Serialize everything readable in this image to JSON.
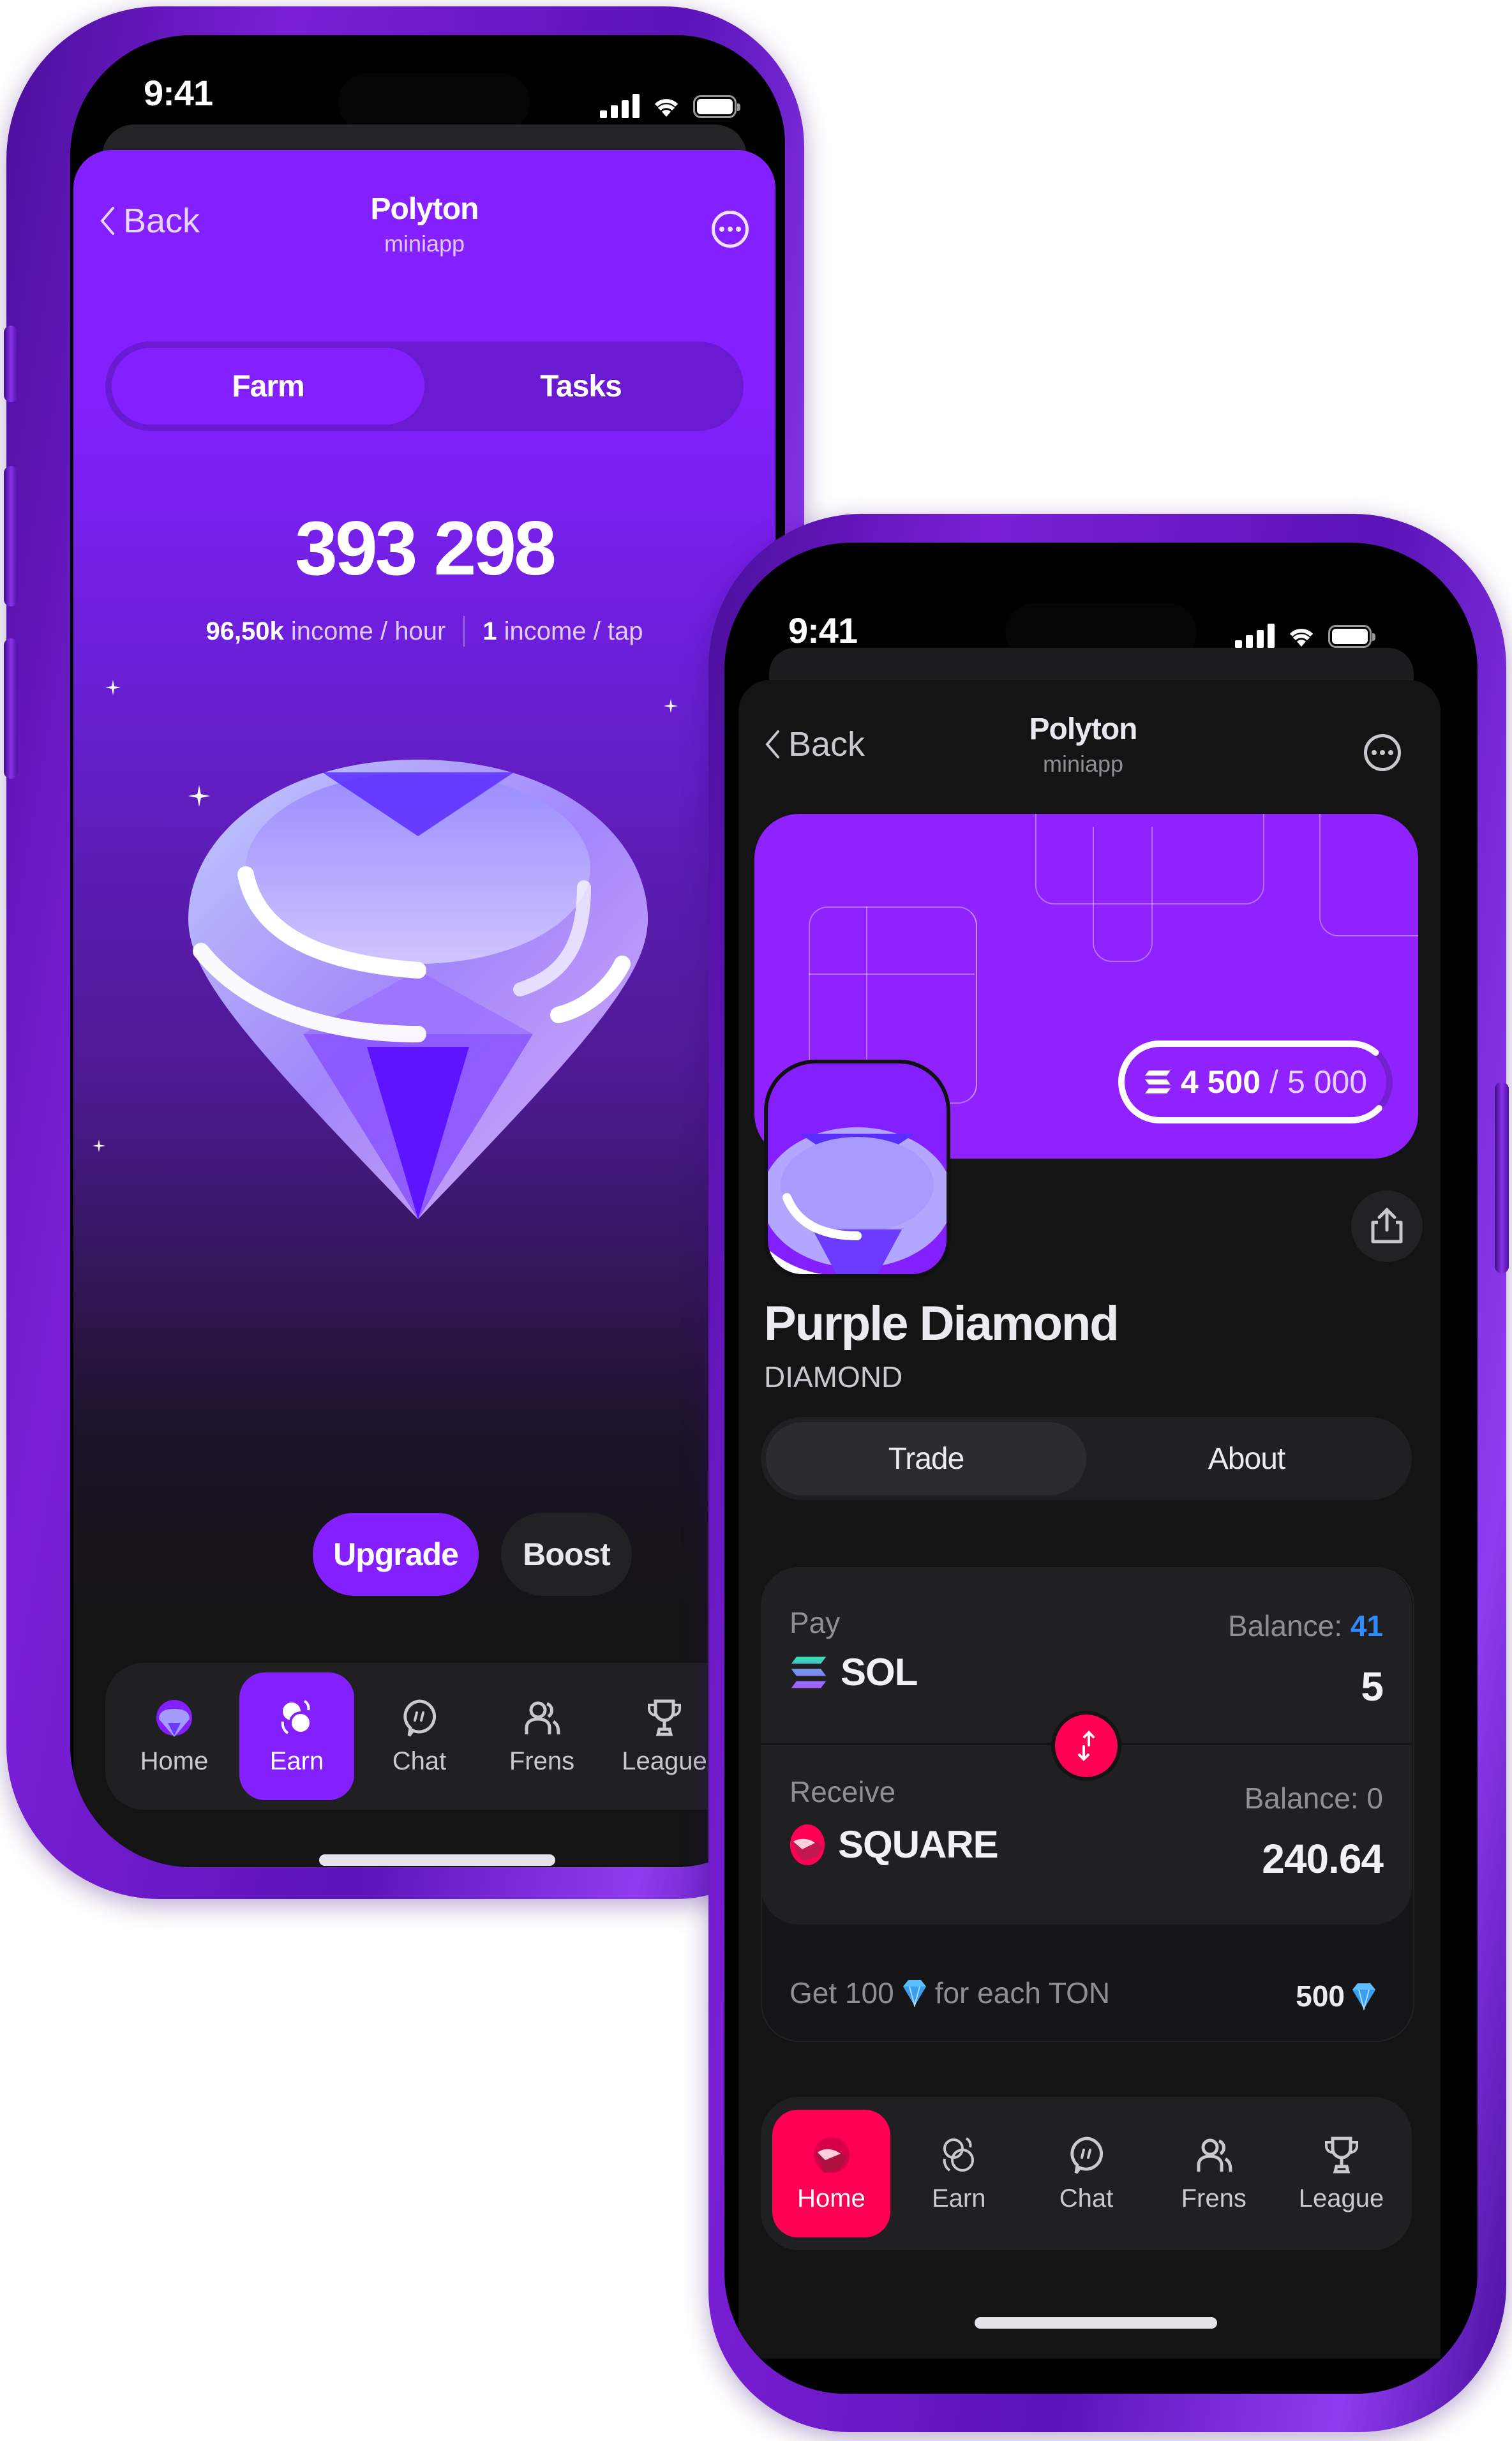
{
  "colors": {
    "brand_purple": "#8420ff",
    "banner_purple": "#9022ff",
    "accent_pink": "#ff0055",
    "balance_blue": "#2f8bff",
    "dark_bg": "#141414",
    "card_bg": "#202023"
  },
  "status_bar": {
    "time": "9:41"
  },
  "left_phone": {
    "header": {
      "back_label": "Back",
      "title": "Polyton",
      "subtitle": "miniapp",
      "more_icon": "more-options-icon"
    },
    "segmented": {
      "tabs": [
        {
          "label": "Farm",
          "active": true
        },
        {
          "label": "Tasks",
          "active": false
        }
      ]
    },
    "balance": {
      "value": "393 298",
      "income_hour_value": "96,50k",
      "income_hour_label": "income / hour",
      "income_tap_value": "1",
      "income_tap_label": "income / tap"
    },
    "hero_image": "purple-diamond-gem",
    "actions": {
      "upgrade_label": "Upgrade",
      "boost_label": "Boost"
    },
    "nav": [
      {
        "label": "Home",
        "icon": "gem-home-icon",
        "active": false
      },
      {
        "label": "Earn",
        "icon": "coins-icon",
        "active": true
      },
      {
        "label": "Chat",
        "icon": "chat-bubble-icon",
        "active": false
      },
      {
        "label": "Frens",
        "icon": "friends-icon",
        "active": false
      },
      {
        "label": "League",
        "icon": "trophy-icon",
        "active": false
      }
    ]
  },
  "right_phone": {
    "header": {
      "back_label": "Back",
      "title": "Polyton",
      "subtitle": "miniapp",
      "more_icon": "more-options-icon"
    },
    "banner": {
      "progress_current": "4 500",
      "progress_separator": "/",
      "progress_total": "5 000",
      "progress_fraction": 0.9,
      "currency_icon": "solana-icon"
    },
    "token": {
      "name": "Purple Diamond",
      "ticker": "DIAMOND",
      "share_icon": "share-icon"
    },
    "segmented": {
      "tabs": [
        {
          "label": "Trade",
          "active": true
        },
        {
          "label": "About",
          "active": false
        }
      ]
    },
    "swap": {
      "pay": {
        "label": "Pay",
        "balance_label": "Balance:",
        "balance_value": "41",
        "token": "SOL",
        "amount": "5"
      },
      "receive": {
        "label": "Receive",
        "balance_label": "Balance:",
        "balance_value": "0",
        "token": "SQUARE",
        "amount": "240.64"
      },
      "swap_icon": "swap-arrows-icon",
      "bonus_prefix": "Get 100",
      "bonus_suffix": "for each TON",
      "bonus_total": "500"
    },
    "nav": [
      {
        "label": "Home",
        "icon": "gem-home-icon",
        "active": true
      },
      {
        "label": "Earn",
        "icon": "coins-icon",
        "active": false
      },
      {
        "label": "Chat",
        "icon": "chat-bubble-icon",
        "active": false
      },
      {
        "label": "Frens",
        "icon": "friends-icon",
        "active": false
      },
      {
        "label": "League",
        "icon": "trophy-icon",
        "active": false
      }
    ]
  }
}
